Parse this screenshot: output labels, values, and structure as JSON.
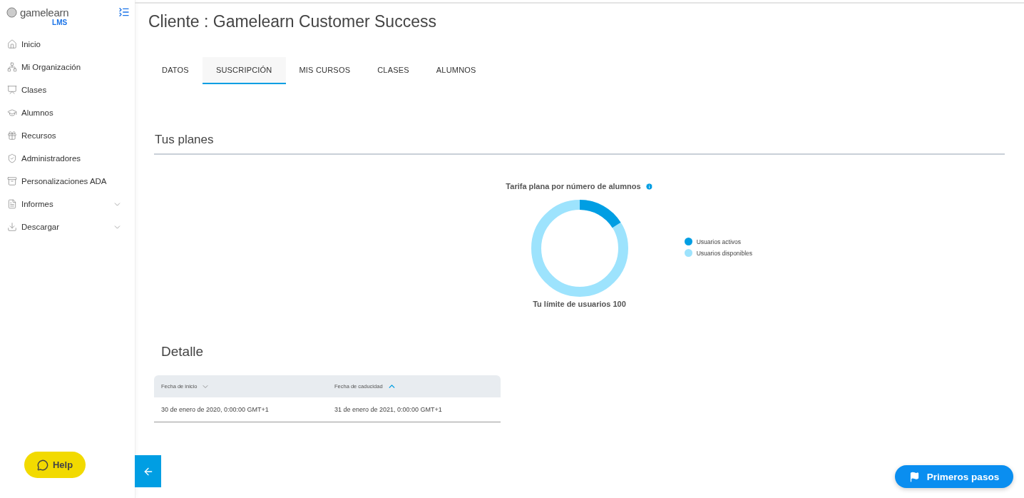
{
  "sidebar": {
    "logo": {
      "name": "gamelearn",
      "product": "LMS"
    },
    "items": [
      {
        "label": "Inicio",
        "expandable": false
      },
      {
        "label": "Mi Organización",
        "expandable": false
      },
      {
        "label": "Clases",
        "expandable": false
      },
      {
        "label": "Alumnos",
        "expandable": false
      },
      {
        "label": "Recursos",
        "expandable": false
      },
      {
        "label": "Administradores",
        "expandable": false
      },
      {
        "label": "Personalizaciones ADA",
        "expandable": false
      },
      {
        "label": "Informes",
        "expandable": true
      },
      {
        "label": "Descargar",
        "expandable": true
      }
    ],
    "help_button": "Help"
  },
  "page": {
    "title": "Cliente : Gamelearn Customer Success",
    "tabs": [
      {
        "label": "DATOS",
        "selected": false
      },
      {
        "label": "SUSCRIPCIÓN",
        "selected": true
      },
      {
        "label": "MIS CURSOS",
        "selected": false
      },
      {
        "label": "CLASES",
        "selected": false
      },
      {
        "label": "ALUMNOS",
        "selected": false
      }
    ],
    "plans": {
      "heading": "Tus planes",
      "chart_title": "Tarifa plana por número de alumnos",
      "legend": [
        {
          "label": "Usuarios activos",
          "color": "#009ee3"
        },
        {
          "label": "Usuarios disponibles",
          "color": "#9de3fd"
        }
      ],
      "caption": "Tu límite de usuarios 100"
    },
    "detail": {
      "heading": "Detalle",
      "columns": [
        {
          "label": "Fecha de inicio",
          "sort_active": false
        },
        {
          "label": "Fecha de caducidad",
          "sort_active": true
        }
      ],
      "rows": [
        [
          "30 de enero de 2020, 0:00:00 GMT+1",
          "31 de enero de 2021, 0:00:00 GMT+1"
        ]
      ]
    }
  },
  "first_steps_button": "Primeros pasos"
}
